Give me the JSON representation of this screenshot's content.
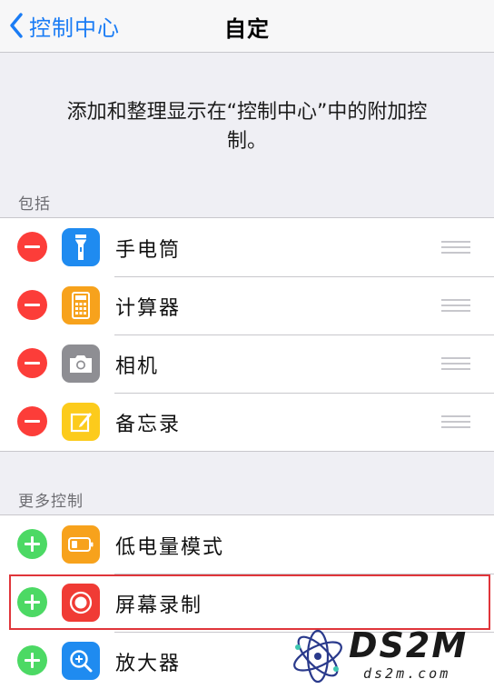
{
  "nav": {
    "back_label": "控制中心",
    "title": "自定"
  },
  "description": "添加和整理显示在“控制中心”中的附加控制。",
  "sections": {
    "included": {
      "header": "包括",
      "items": [
        {
          "label": "手电筒",
          "icon": "flashlight-icon",
          "color": "#1f8bf0"
        },
        {
          "label": "计算器",
          "icon": "calculator-icon",
          "color": "#f7a21c"
        },
        {
          "label": "相机",
          "icon": "camera-icon",
          "color": "#8e8e93"
        },
        {
          "label": "备忘录",
          "icon": "notes-icon",
          "color": "#fccb1c"
        }
      ]
    },
    "more": {
      "header": "更多控制",
      "items": [
        {
          "label": "低电量模式",
          "icon": "battery-icon",
          "color": "#f7a21c"
        },
        {
          "label": "屏幕录制",
          "icon": "screen-record-icon",
          "color": "#f03b35"
        },
        {
          "label": "放大器",
          "icon": "magnifier-icon",
          "color": "#1f8bf0"
        }
      ]
    }
  },
  "watermark": {
    "brand": "DS2M",
    "site": "ds2m.com"
  },
  "colors": {
    "accent": "#1a7cf5",
    "remove": "#fc3d39",
    "add": "#4cd964",
    "highlight": "#e0353a"
  }
}
